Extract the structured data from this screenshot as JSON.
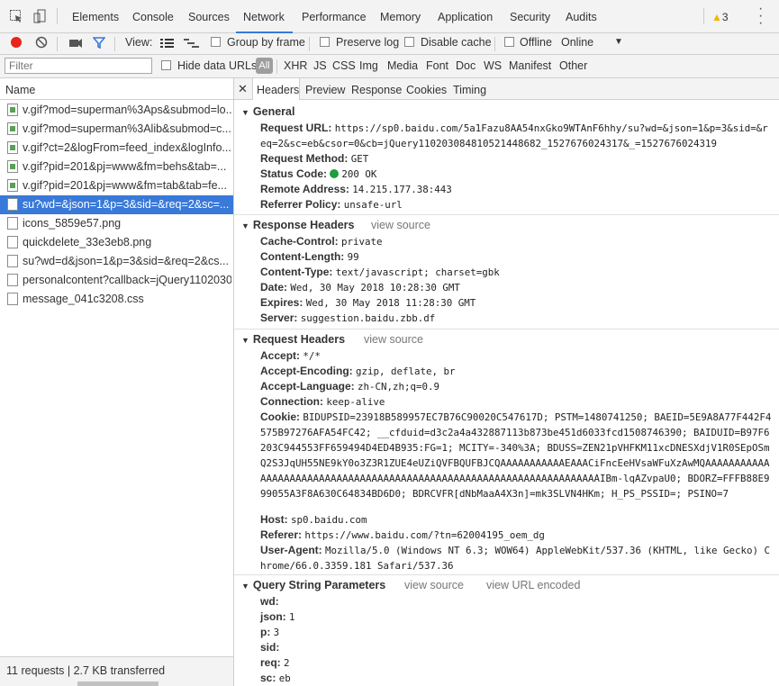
{
  "tabs": [
    "Elements",
    "Console",
    "Sources",
    "Network",
    "Performance",
    "Memory",
    "Application",
    "Security",
    "Audits"
  ],
  "active_tab": "Network",
  "warning_count": "3",
  "toolbar": {
    "view_label": "View:",
    "group_by_frame": "Group by frame",
    "preserve_log": "Preserve log",
    "disable_cache": "Disable cache",
    "offline": "Offline",
    "throttle": "Online"
  },
  "filter": {
    "placeholder": "Filter",
    "hide_data_urls": "Hide data URLs",
    "types": [
      "All",
      "XHR",
      "JS",
      "CSS",
      "Img",
      "Media",
      "Font",
      "Doc",
      "WS",
      "Manifest",
      "Other"
    ]
  },
  "colors": {
    "accent": "#3879d9",
    "status_green": "#1e9e3a",
    "warning": "#f4b400"
  },
  "requests": {
    "header": "Name",
    "items": [
      {
        "name": "v.gif?mod=superman%3Aps&submod=lo...",
        "icon": "image-file-icon"
      },
      {
        "name": "v.gif?mod=superman%3Alib&submod=c...",
        "icon": "image-file-icon"
      },
      {
        "name": "v.gif?ct=2&logFrom=feed_index&logInfo...",
        "icon": "image-file-icon"
      },
      {
        "name": "v.gif?pid=201&pj=www&fm=behs&tab=...",
        "icon": "image-file-icon"
      },
      {
        "name": "v.gif?pid=201&pj=www&fm=tab&tab=fe...",
        "icon": "image-file-icon"
      },
      {
        "name": "su?wd=&json=1&p=3&sid=&req=2&sc=...",
        "icon": "document-icon",
        "selected": true
      },
      {
        "name": "icons_5859e57.png",
        "icon": "document-icon"
      },
      {
        "name": "quickdelete_33e3eb8.png",
        "icon": "document-icon"
      },
      {
        "name": "su?wd=d&json=1&p=3&sid=&req=2&cs...",
        "icon": "document-icon"
      },
      {
        "name": "personalcontent?callback=jQuery1102030...",
        "icon": "document-icon"
      },
      {
        "name": "message_041c3208.css",
        "icon": "document-icon"
      }
    ],
    "summary": "11 requests  |  2.7 KB transferred"
  },
  "detail": {
    "tabs": [
      "Headers",
      "Preview",
      "Response",
      "Cookies",
      "Timing"
    ],
    "active_tab": "Headers",
    "general": {
      "title": "General",
      "request_url_k": "Request URL:",
      "request_url_v": "https://sp0.baidu.com/5a1Fazu8AA54nxGko9WTAnF6hhy/su?wd=&json=1&p=3&sid=&req=2&sc=eb&csor=0&cb=jQuery110203084810521448682_1527676024317&_=1527676024319",
      "method_k": "Request Method:",
      "method_v": "GET",
      "status_k": "Status Code:",
      "status_v": "200 OK",
      "remote_k": "Remote Address:",
      "remote_v": "14.215.177.38:443",
      "referrer_k": "Referrer Policy:",
      "referrer_v": "unsafe-url"
    },
    "response_headers": {
      "title": "Response Headers",
      "view_source": "view source",
      "items": [
        {
          "k": "Cache-Control:",
          "v": "private"
        },
        {
          "k": "Content-Length:",
          "v": "99"
        },
        {
          "k": "Content-Type:",
          "v": "text/javascript; charset=gbk"
        },
        {
          "k": "Date:",
          "v": "Wed, 30 May 2018 10:28:30 GMT"
        },
        {
          "k": "Expires:",
          "v": "Wed, 30 May 2018 11:28:30 GMT"
        },
        {
          "k": "Server:",
          "v": "suggestion.baidu.zbb.df"
        }
      ]
    },
    "request_headers": {
      "title": "Request Headers",
      "view_source": "view source",
      "accept_k": "Accept:",
      "accept_v": "*/*",
      "enc_k": "Accept-Encoding:",
      "enc_v": "gzip, deflate, br",
      "lang_k": "Accept-Language:",
      "lang_v": "zh-CN,zh;q=0.9",
      "conn_k": "Connection:",
      "conn_v": "keep-alive",
      "cookie_k": "Cookie:",
      "cookie_v": "BIDUPSID=23918B589957EC7B76C90020C547617D; PSTM=1480741250; BAEID=5E9A8A77F442F4575B97276AFA54FC42; __cfduid=d3c2a4a432887113b873be451d6033fcd1508746390; BAIDUID=B97F6203C944553FF659494D4ED4B935:FG=1; MCITY=-340%3A; BDUSS=ZEN21pVHFKM11xcDNESXdjV1R0SEpOSmQ2S3JqUH55NE9kY0o3Z3R1ZUE4eUZiQVFBQUFBJCQAAAAAAAAAAAEAAACiFncEeHVsaWFuXzAwMQAAAAAAAAAAAAAAAAAAAAAAAAAAAAAAAAAAAAAAAAAAAAAAAAAAAAAAAAAAAAAAAAAAAAAIBm-lqAZvpaU0; BDORZ=FFFB88E999055A3F8A630C64834BD6D0; BDRCVFR[dNbMaaA4X3n]=mk3SLVN4HKm; H_PS_PSSID=; PSINO=7",
      "host_k": "Host:",
      "host_v": "sp0.baidu.com",
      "ref_k": "Referer:",
      "ref_v": "https://www.baidu.com/?tn=62004195_oem_dg",
      "ua_k": "User-Agent:",
      "ua_v": "Mozilla/5.0 (Windows NT 6.3; WOW64) AppleWebKit/537.36 (KHTML, like Gecko) Chrome/66.0.3359.181 Safari/537.36"
    },
    "query_string": {
      "title": "Query String Parameters",
      "view_source": "view source",
      "view_url_encoded": "view URL encoded",
      "items": [
        {
          "k": "wd:",
          "v": ""
        },
        {
          "k": "json:",
          "v": "1"
        },
        {
          "k": "p:",
          "v": "3"
        },
        {
          "k": "sid:",
          "v": ""
        },
        {
          "k": "req:",
          "v": "2"
        },
        {
          "k": "sc:",
          "v": "eb"
        }
      ]
    }
  }
}
